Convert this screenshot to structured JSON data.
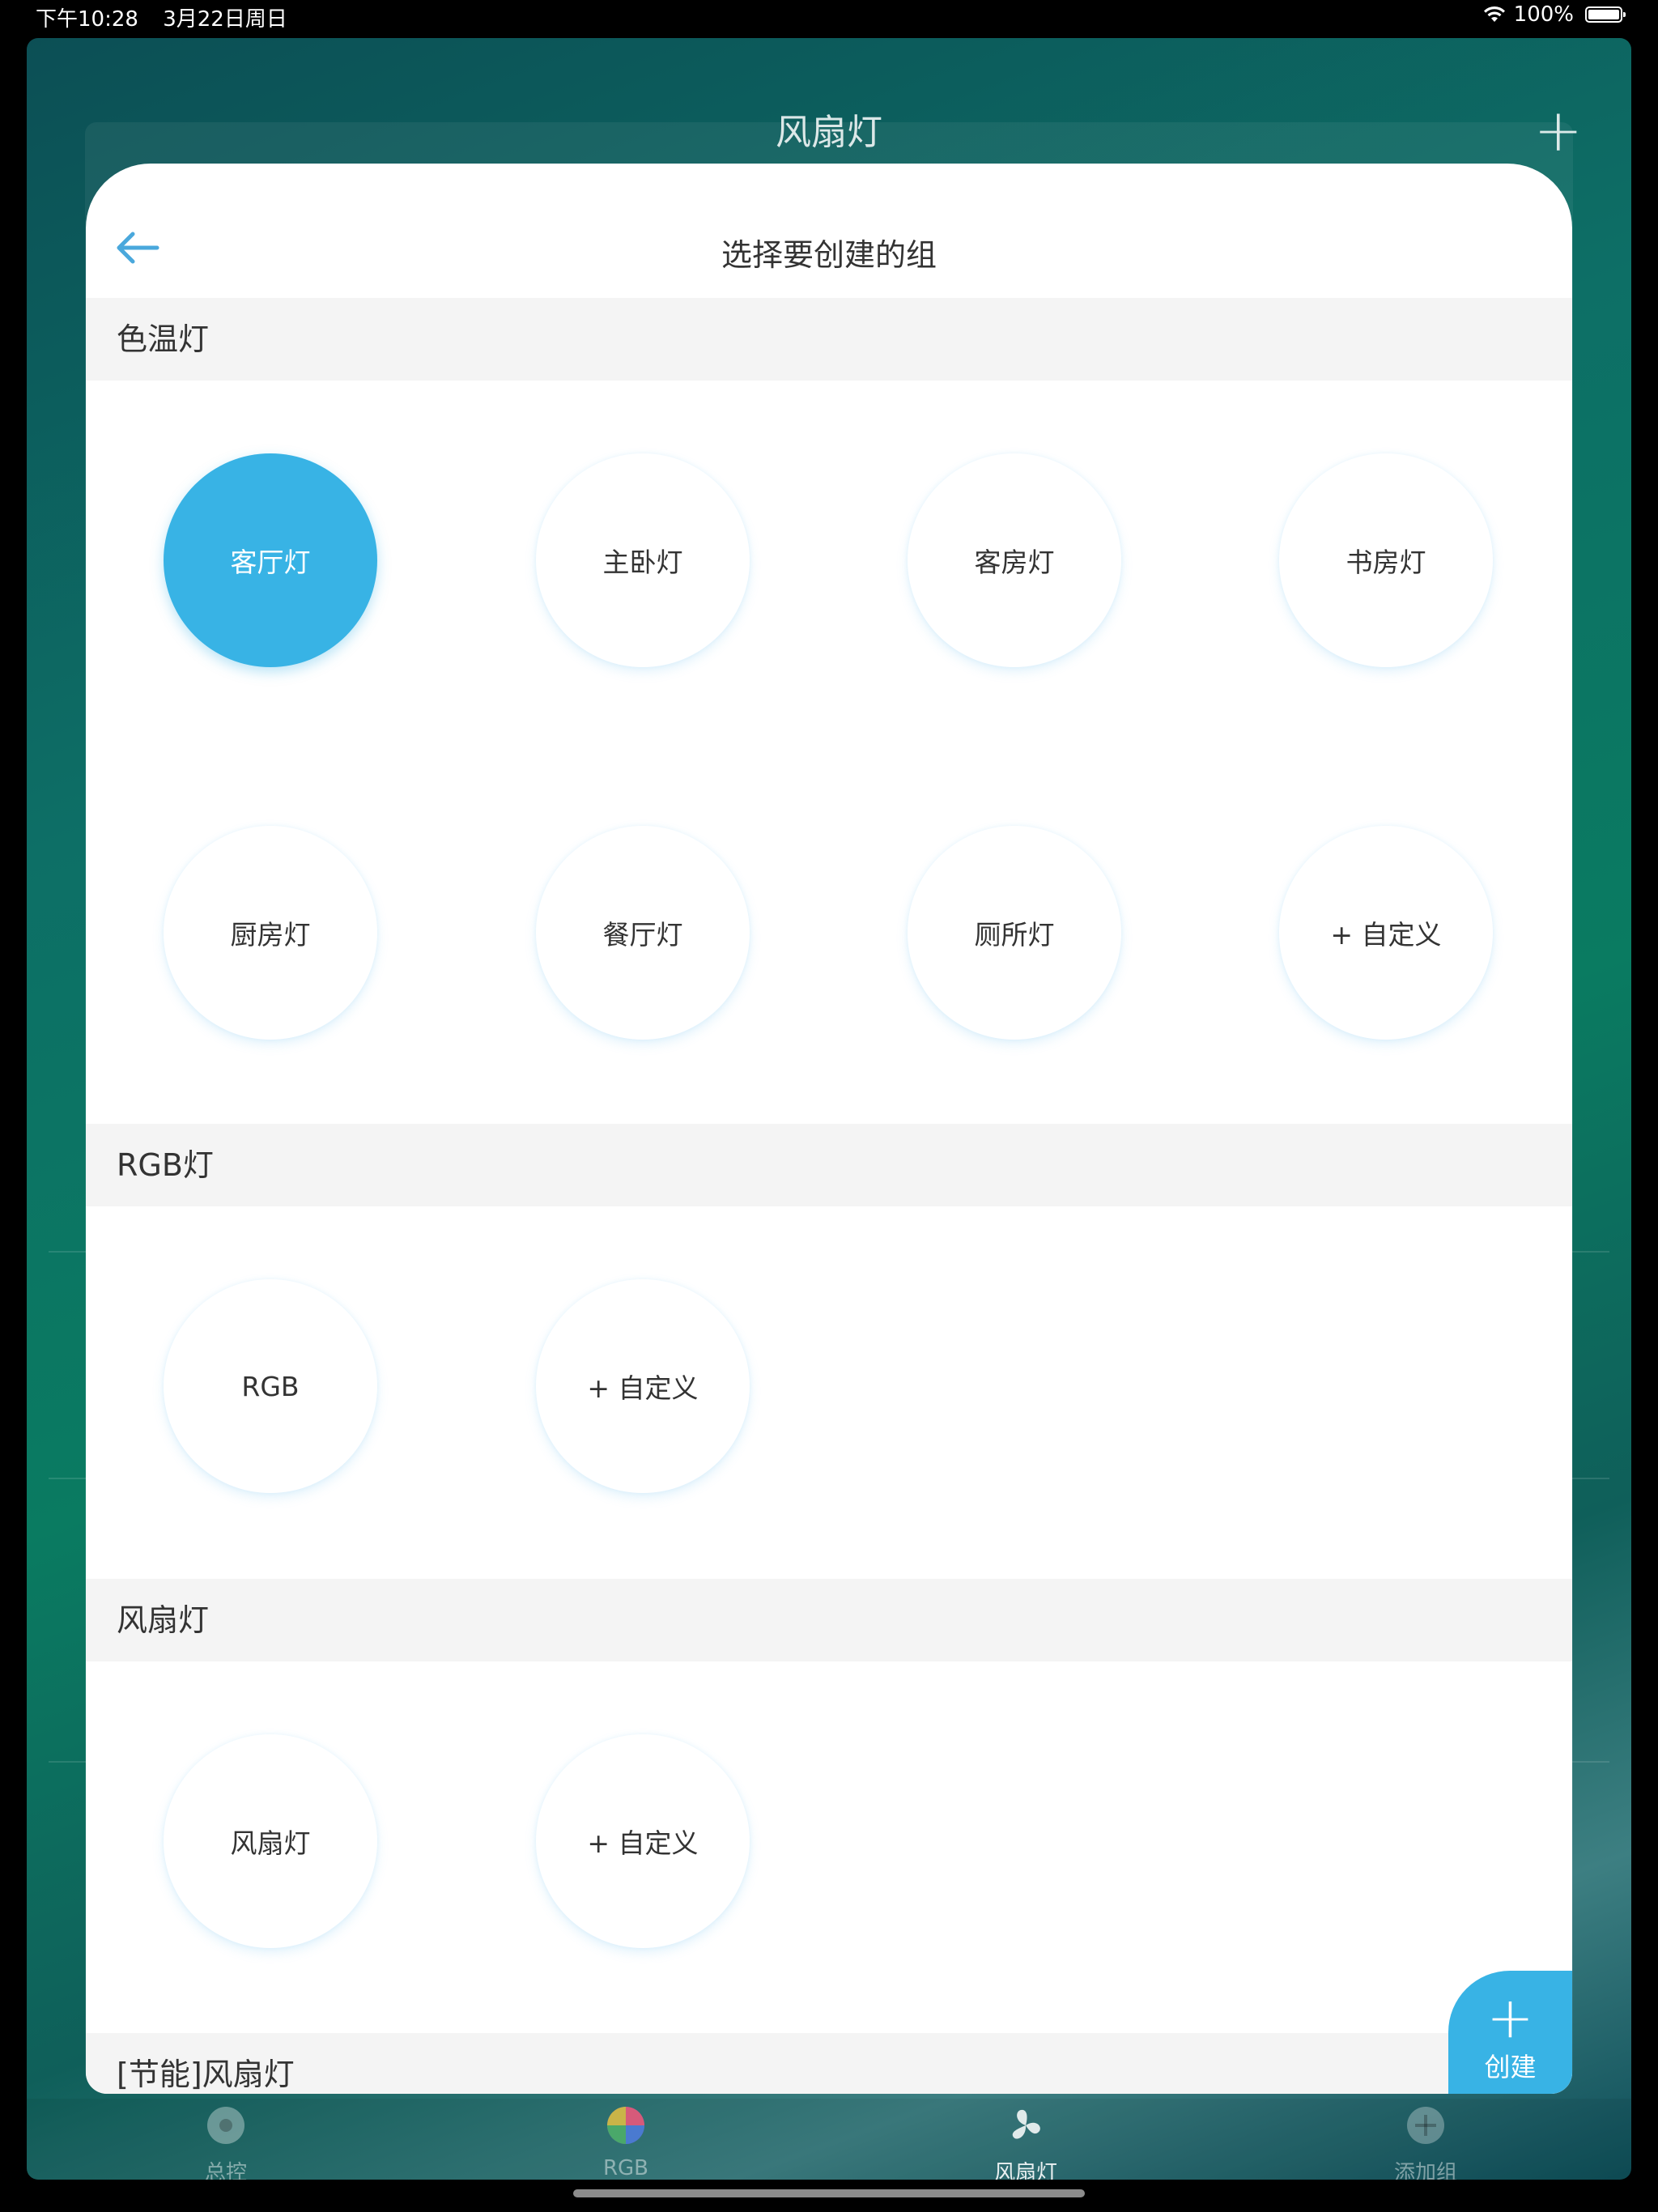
{
  "status_bar": {
    "time": "下午10:28",
    "date": "3月22日周日",
    "battery": "100%"
  },
  "background": {
    "title": "风扇灯",
    "plus": "+",
    "tabs": [
      {
        "label": "总控",
        "icon": "gamepad-icon"
      },
      {
        "label": "RGB",
        "icon": "color-wheel-icon"
      },
      {
        "label": "风扇灯",
        "icon": "fan-icon",
        "active": true
      },
      {
        "label": "添加组",
        "icon": "add-circle-icon"
      }
    ]
  },
  "modal": {
    "title": "选择要创建的组",
    "sections": [
      {
        "title": "色温灯",
        "items": [
          "客厅灯",
          "主卧灯",
          "客房灯",
          "书房灯",
          "厨房灯",
          "餐厅灯",
          "厕所灯",
          "+ 自定义"
        ],
        "selected": "客厅灯"
      },
      {
        "title": "RGB灯",
        "items": [
          "RGB",
          "+ 自定义"
        ]
      },
      {
        "title": "风扇灯",
        "items": [
          "风扇灯",
          "+ 自定义"
        ]
      },
      {
        "title": "[节能]风扇灯",
        "items": []
      }
    ],
    "create_button": {
      "plus": "+",
      "label": "创建"
    }
  },
  "colors": {
    "accent": "#38b3e5",
    "section_bg": "#f4f4f4",
    "text": "#333333"
  }
}
